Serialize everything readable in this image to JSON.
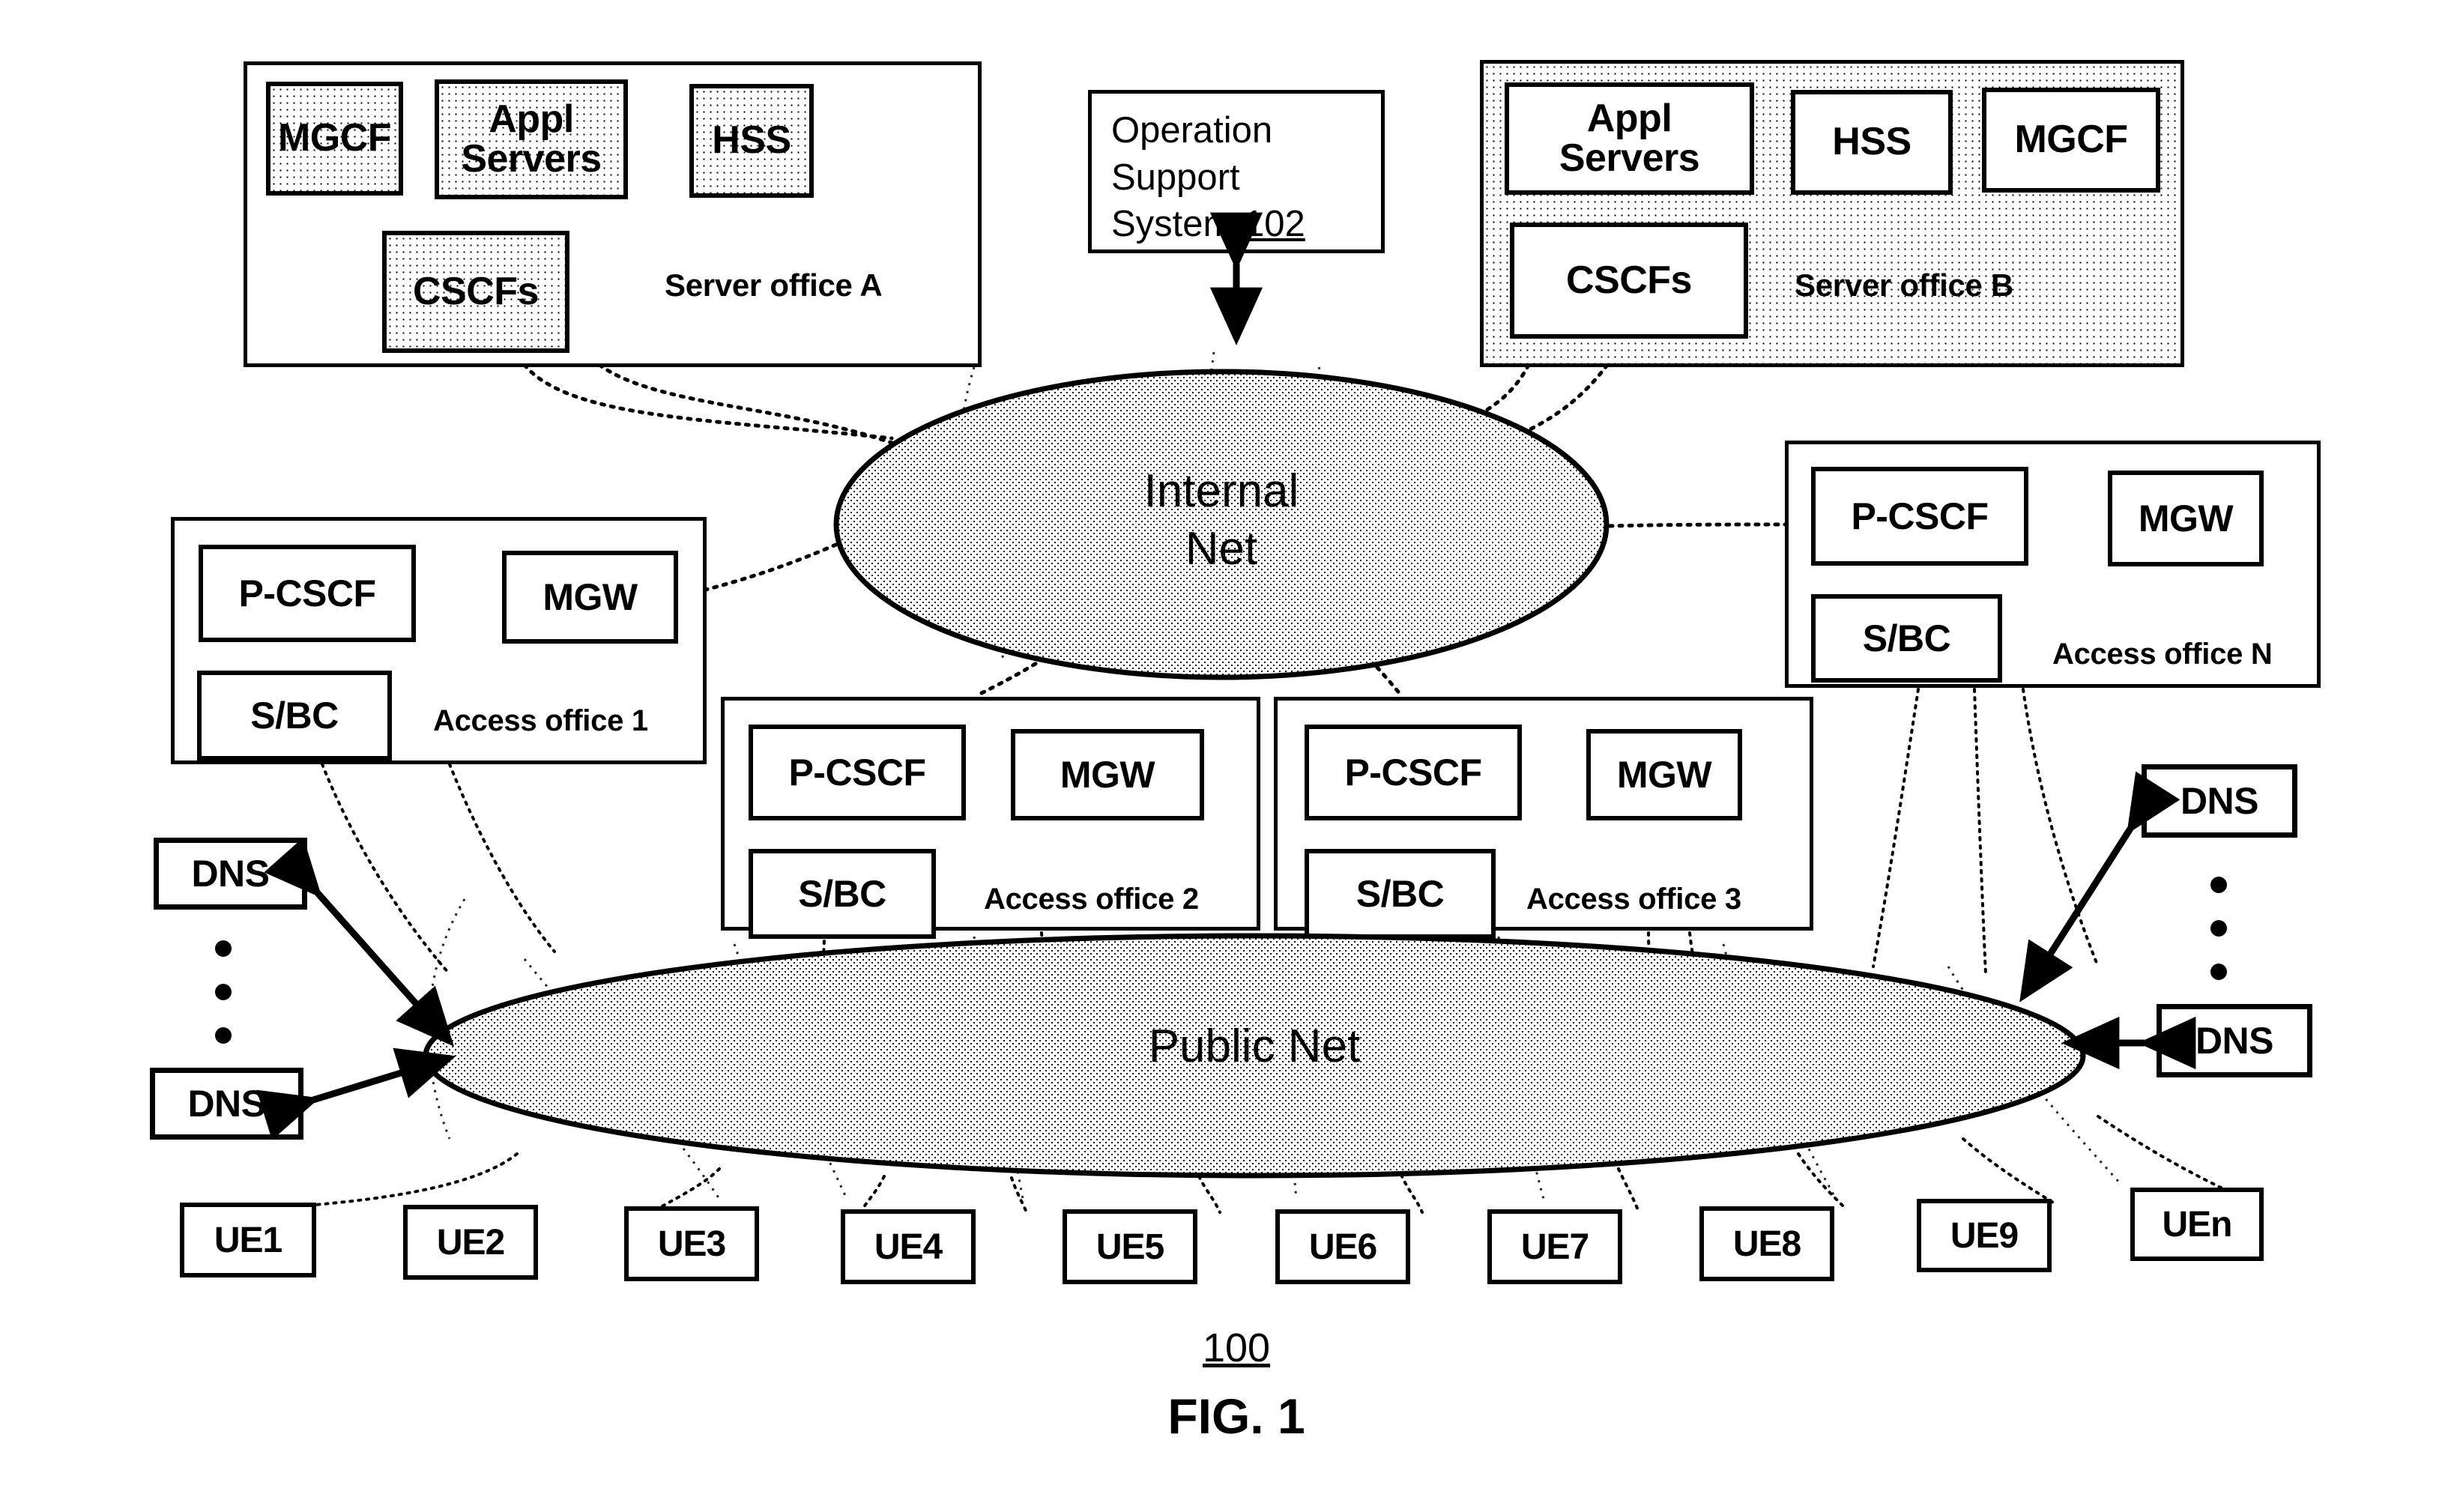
{
  "figure": {
    "number_label": "100",
    "caption": "FIG. 1"
  },
  "oss": {
    "line1": "Operation",
    "line2": "Support",
    "line3": "System ",
    "ref": "102"
  },
  "clouds": {
    "internal": {
      "line1": "Internal",
      "line2": "Net"
    },
    "public": {
      "label": "Public Net"
    }
  },
  "server_office_a": {
    "label": "Server office A",
    "nodes": [
      {
        "label": "MGCF"
      },
      {
        "label": "Appl\nServers"
      },
      {
        "label": "HSS"
      },
      {
        "label": "CSCFs"
      }
    ]
  },
  "server_office_b": {
    "label": "Server office B",
    "nodes": [
      {
        "label": "Appl\nServers"
      },
      {
        "label": "HSS"
      },
      {
        "label": "MGCF"
      },
      {
        "label": "CSCFs"
      }
    ]
  },
  "access_offices": [
    {
      "label": "Access office 1",
      "nodes": [
        {
          "label": "P-CSCF"
        },
        {
          "label": "MGW"
        },
        {
          "label": "S/BC"
        }
      ]
    },
    {
      "label": "Access office 2",
      "nodes": [
        {
          "label": "P-CSCF"
        },
        {
          "label": "MGW"
        },
        {
          "label": "S/BC"
        }
      ]
    },
    {
      "label": "Access office 3",
      "nodes": [
        {
          "label": "P-CSCF"
        },
        {
          "label": "MGW"
        },
        {
          "label": "S/BC"
        }
      ]
    },
    {
      "label": "Access office N",
      "nodes": [
        {
          "label": "P-CSCF"
        },
        {
          "label": "MGW"
        },
        {
          "label": "S/BC"
        }
      ]
    }
  ],
  "dns_left": [
    {
      "label": "DNS"
    },
    {
      "label": "DNS"
    }
  ],
  "dns_right": [
    {
      "label": "DNS"
    },
    {
      "label": "DNS"
    }
  ],
  "user_equipment": [
    {
      "label": "UE1"
    },
    {
      "label": "UE2"
    },
    {
      "label": "UE3"
    },
    {
      "label": "UE4"
    },
    {
      "label": "UE5"
    },
    {
      "label": "UE6"
    },
    {
      "label": "UE7"
    },
    {
      "label": "UE8"
    },
    {
      "label": "UE9"
    },
    {
      "label": "UEn"
    }
  ],
  "colors": {
    "stroke": "#000000",
    "fill": "#ffffff",
    "shade": "#000000"
  }
}
